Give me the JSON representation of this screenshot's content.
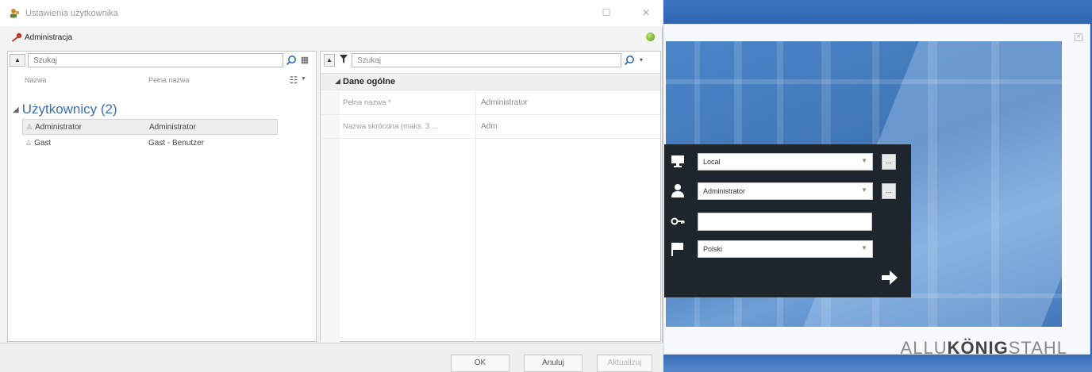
{
  "dialog": {
    "title": "Ustawienia użytkownika",
    "module": "Administracja",
    "left": {
      "search_placeholder": "Szukaj",
      "col_name": "Nazwa",
      "col_fullname": "Pełna nazwa",
      "group_label": "Użytkownicy (2)",
      "users": [
        {
          "name": "Administrator",
          "full_name": "Administrator",
          "selected": true
        },
        {
          "name": "Gast",
          "full_name": "Gast - Benutzer",
          "selected": false
        }
      ]
    },
    "right": {
      "search_value": "Szukaj",
      "section": "Dane ogólne",
      "properties": [
        {
          "label": "Pełna nazwa *",
          "value": "Administrator"
        },
        {
          "label": "Nazwa skrócona (maks. 3 ...",
          "value": "Adm"
        }
      ]
    },
    "buttons": {
      "ok": "OK",
      "cancel": "Anuluj",
      "apply": "Aktualizuj"
    }
  },
  "login": {
    "server": "Local",
    "user": "Administrator",
    "password": "",
    "language": "Polski",
    "more_label": "...",
    "brand_light_1": "ALLU",
    "brand_bold": "KÖNIG",
    "brand_light_2": "STAHL"
  },
  "colors": {
    "group_header": "#3b6fb6",
    "login_panel": "#1f252c",
    "status_ok": "#6aa82a"
  }
}
